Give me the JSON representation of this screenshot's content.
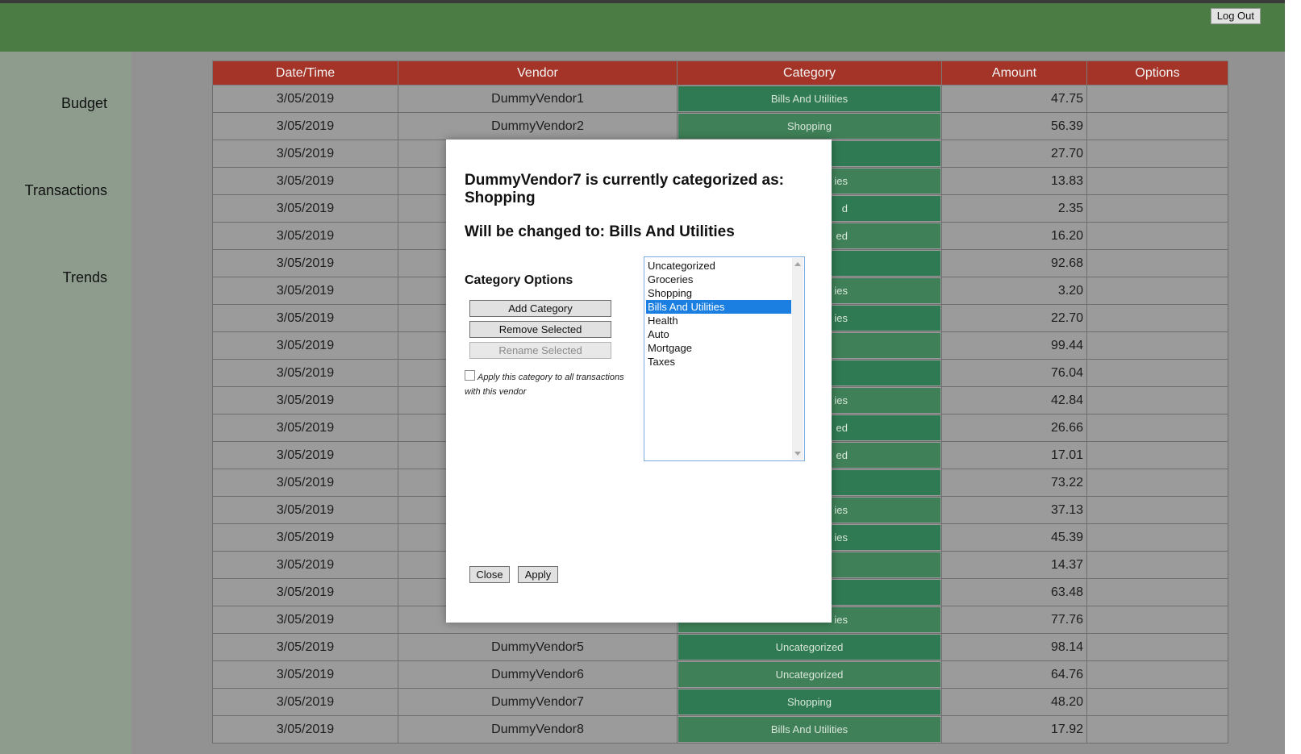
{
  "header": {
    "logout_label": "Log Out",
    "color": "#4a7c44"
  },
  "sidebar": {
    "items": [
      {
        "label": "Budget"
      },
      {
        "label": "Transactions"
      },
      {
        "label": "Trends"
      }
    ]
  },
  "table": {
    "columns": [
      "Date/Time",
      "Vendor",
      "Category",
      "Amount",
      "Options"
    ],
    "header_color": "#a33427",
    "rows": [
      {
        "date": "3/05/2019",
        "vendor": "DummyVendor1",
        "category": "Bills And Utilities",
        "amount": "47.75"
      },
      {
        "date": "3/05/2019",
        "vendor": "DummyVendor2",
        "category": "Shopping",
        "amount": "56.39"
      },
      {
        "date": "3/05/2019",
        "vendor": "",
        "category": "",
        "amount": "27.70"
      },
      {
        "date": "3/05/2019",
        "vendor": "",
        "category": "ies",
        "amount": "13.83"
      },
      {
        "date": "3/05/2019",
        "vendor": "",
        "category": "d",
        "amount": "2.35"
      },
      {
        "date": "3/05/2019",
        "vendor": "",
        "category": "ed",
        "amount": "16.20"
      },
      {
        "date": "3/05/2019",
        "vendor": "",
        "category": "",
        "amount": "92.68"
      },
      {
        "date": "3/05/2019",
        "vendor": "",
        "category": "ies",
        "amount": "3.20"
      },
      {
        "date": "3/05/2019",
        "vendor": "",
        "category": "ies",
        "amount": "22.70"
      },
      {
        "date": "3/05/2019",
        "vendor": "",
        "category": "",
        "amount": "99.44"
      },
      {
        "date": "3/05/2019",
        "vendor": "",
        "category": "",
        "amount": "76.04"
      },
      {
        "date": "3/05/2019",
        "vendor": "",
        "category": "ies",
        "amount": "42.84"
      },
      {
        "date": "3/05/2019",
        "vendor": "",
        "category": "ed",
        "amount": "26.66"
      },
      {
        "date": "3/05/2019",
        "vendor": "",
        "category": "ed",
        "amount": "17.01"
      },
      {
        "date": "3/05/2019",
        "vendor": "",
        "category": "",
        "amount": "73.22"
      },
      {
        "date": "3/05/2019",
        "vendor": "",
        "category": "ies",
        "amount": "37.13"
      },
      {
        "date": "3/05/2019",
        "vendor": "",
        "category": "ies",
        "amount": "45.39"
      },
      {
        "date": "3/05/2019",
        "vendor": "",
        "category": "",
        "amount": "14.37"
      },
      {
        "date": "3/05/2019",
        "vendor": "",
        "category": "",
        "amount": "63.48"
      },
      {
        "date": "3/05/2019",
        "vendor": "",
        "category": "ies",
        "amount": "77.76"
      },
      {
        "date": "3/05/2019",
        "vendor": "DummyVendor5",
        "category": "Uncategorized",
        "amount": "98.14"
      },
      {
        "date": "3/05/2019",
        "vendor": "DummyVendor6",
        "category": "Uncategorized",
        "amount": "64.76"
      },
      {
        "date": "3/05/2019",
        "vendor": "DummyVendor7",
        "category": "Shopping",
        "amount": "48.20"
      },
      {
        "date": "3/05/2019",
        "vendor": "DummyVendor8",
        "category": "Bills And Utilities",
        "amount": "17.92"
      }
    ]
  },
  "modal": {
    "title": "DummyVendor7 is currently categorized as: Shopping",
    "change_text": "Will be changed to: Bills And Utilities",
    "options_heading": "Category Options",
    "add_label": "Add Category",
    "remove_label": "Remove Selected",
    "rename_label": "Rename Selected",
    "apply_all_label": "Apply this category to all transactions with this vendor",
    "apply_all_checked": false,
    "categories": [
      "Uncategorized",
      "Groceries",
      "Shopping",
      "Bills And Utilities",
      "Health",
      "Auto",
      "Mortgage",
      "Taxes"
    ],
    "selected_category": "Bills And Utilities",
    "close_label": "Close",
    "apply_label": "Apply"
  }
}
